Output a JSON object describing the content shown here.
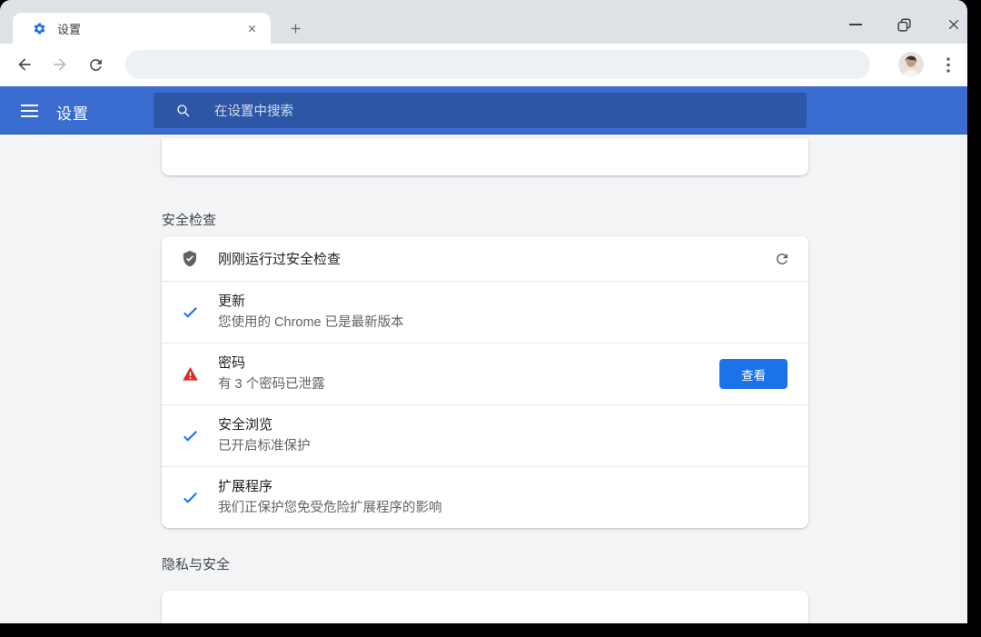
{
  "browser": {
    "tab_title": "设置"
  },
  "settings_header": {
    "title": "设置",
    "search_placeholder": "在设置中搜索"
  },
  "safety_check": {
    "heading": "安全检查",
    "status_text": "刚刚运行过安全检查",
    "rows": [
      {
        "status": "ok",
        "title": "更新",
        "subtitle": "您使用的 Chrome 已是最新版本"
      },
      {
        "status": "warning",
        "title": "密码",
        "subtitle": "有 3 个密码已泄露",
        "action_label": "查看"
      },
      {
        "status": "ok",
        "title": "安全浏览",
        "subtitle": "已开启标准保护"
      },
      {
        "status": "ok",
        "title": "扩展程序",
        "subtitle": "我们正保护您免受危险扩展程序的影响"
      }
    ]
  },
  "privacy_section": {
    "heading": "隐私与安全"
  },
  "colors": {
    "header_blue": "#3b6dd1",
    "search_field_blue": "#2d57a6",
    "action_blue": "#1a73e8",
    "ok_check_blue": "#1a73e8",
    "warning_red": "#d93025",
    "shield_gray": "#5f6368"
  }
}
